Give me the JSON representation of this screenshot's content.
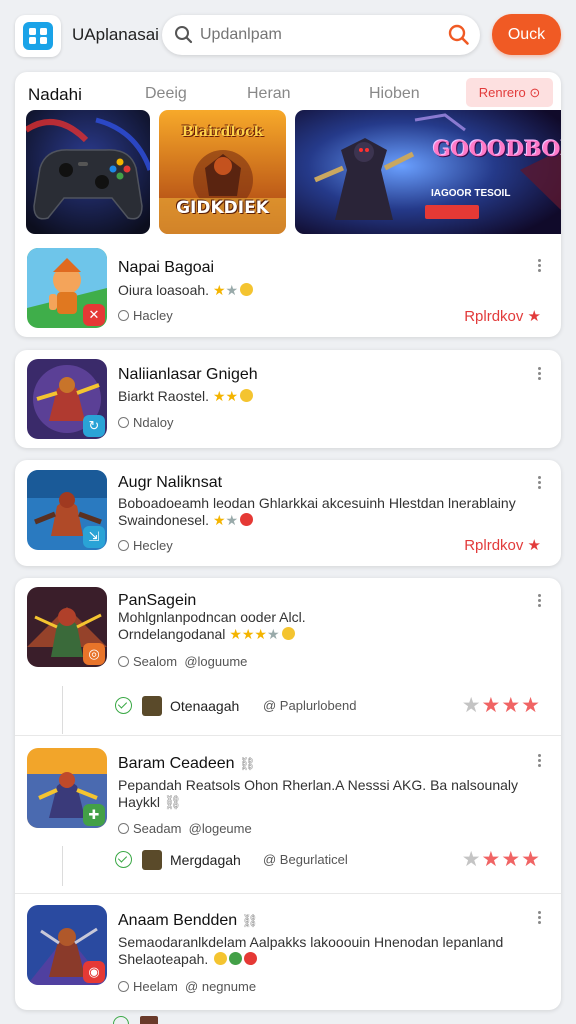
{
  "header": {
    "app_title": "UAplanasai",
    "search_placeholder": "Updanlpam",
    "action_button": "Ouck",
    "icons": [
      "app-logo-icon",
      "search-icon",
      "search-submit-icon"
    ]
  },
  "tabs": {
    "items": [
      "Nadahi",
      "Deeig",
      "Heran",
      "Hioben"
    ],
    "active_index": 0,
    "button": "Renrero"
  },
  "banners": [
    {
      "name": "controller"
    },
    {
      "name": "Blairdlock",
      "subtitle": "GIDKDIEK"
    },
    {
      "name": "GOOODBOK",
      "caption": "IAGOOR TESOIL"
    }
  ],
  "apps": [
    {
      "title": "Napai Bagoai",
      "desc": "Oiura loasoah.",
      "meta": "Hacley",
      "action": "Rplrdkov",
      "rating_shown": 2,
      "badge_color": "#e53935"
    },
    {
      "title": "Naliianlasar Gnigeh",
      "desc": "Biarkt Raostel.",
      "meta": "Ndaloy",
      "rating_shown": 2,
      "badge_color": "#2aa3d6"
    },
    {
      "title": "Augr Naliknsat",
      "desc": "Boboadoeamh leodan Ghlarkkai akcesuinh Hlestdan lnerablainy Swaindonesel.",
      "meta": "Hecley",
      "action": "Rplrdkov",
      "rating_shown": 2,
      "badge_color": "#2aa3d6"
    },
    {
      "title": "PanSagein",
      "desc_line1": "Mohlgnlanpodncan ooder Alcl.",
      "desc_line2": "Orndelangodanal",
      "meta_left": "Sealom",
      "meta_right": "@loguume",
      "badge_color": "#e8742a",
      "sub": {
        "name": "Otenaagah",
        "dev": "@ Paplurlobend",
        "stars_grey": 1,
        "stars_red": 3
      }
    },
    {
      "title": "Baram Ceadeen",
      "desc_line1": "Pepandah Reatsols Ohon Rherlan.A Nesssi AKG. Ba nalsounaly",
      "desc_line2": "Haykkl",
      "meta_left": "Seadam",
      "meta_right": "@logeume",
      "badge_color": "#43a047",
      "sub": {
        "name": "Mergdagah",
        "dev": "@ Begurlaticel",
        "stars_grey": 1,
        "stars_red": 3
      }
    },
    {
      "title": "Anaam Bendden",
      "desc_line1": "Semaodaranlkdelam Aalpakks lakooouin Hnenodan lepanland",
      "desc_line2": "Shelaoteapah.",
      "meta_left": "Heelam",
      "meta_right": "@ negnume",
      "badge_color": "#e53935"
    }
  ],
  "colors": {
    "accent": "#f05a24",
    "red": "#e23b3b",
    "star_gold": "#f4b400",
    "check_green": "#3aa845"
  }
}
